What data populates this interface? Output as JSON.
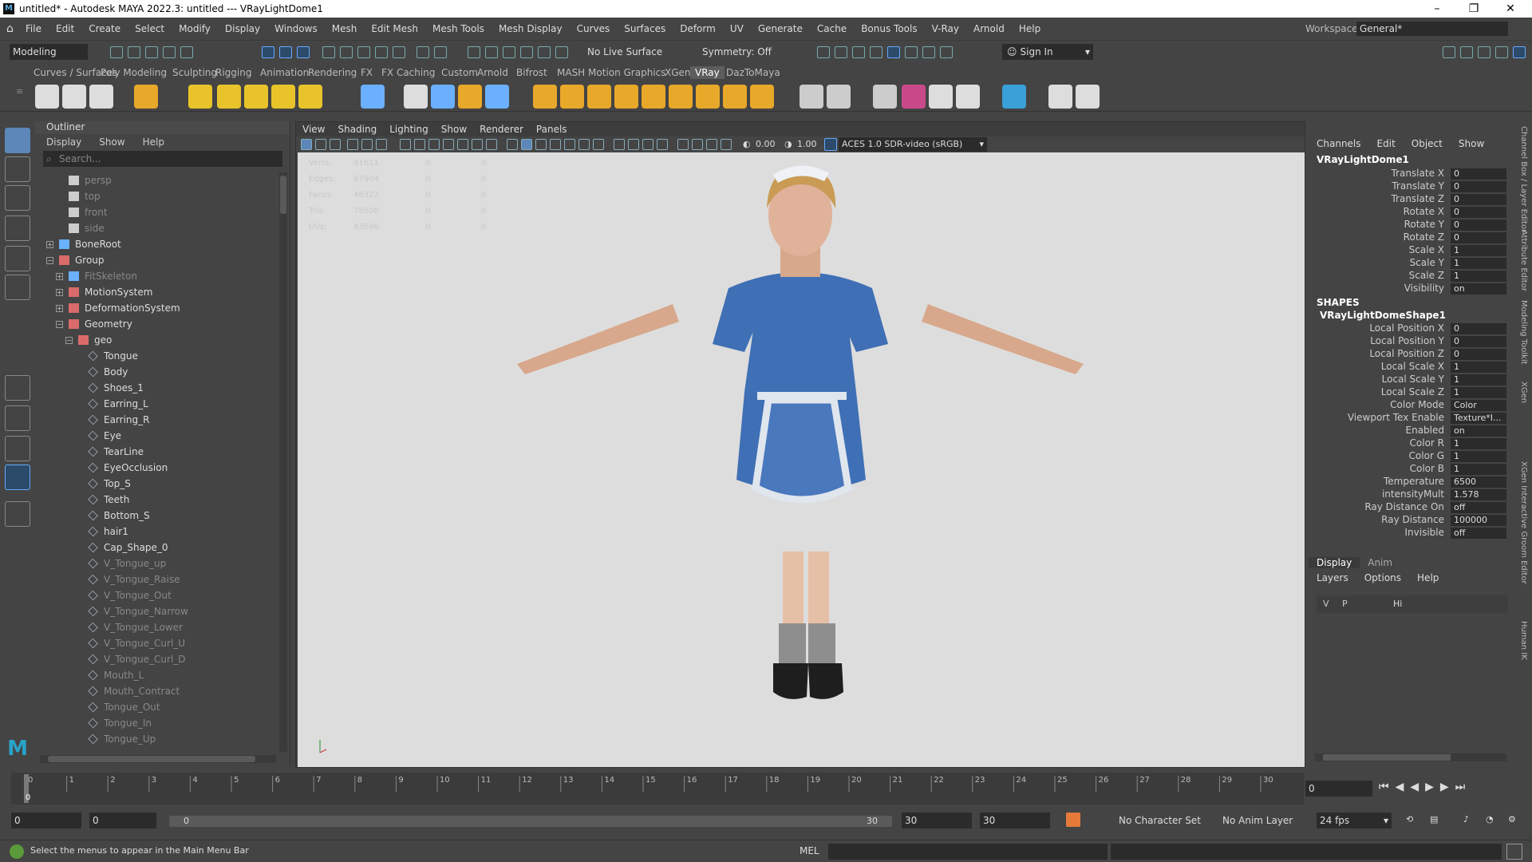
{
  "window": {
    "title": "untitled* - Autodesk MAYA 2022.3: untitled  ---  VRayLightDome1",
    "minimize": "–",
    "maximize": "❐",
    "close": "✕"
  },
  "menubar": {
    "items": [
      "File",
      "Edit",
      "Create",
      "Select",
      "Modify",
      "Display",
      "Windows",
      "Mesh",
      "Edit Mesh",
      "Mesh Tools",
      "Mesh Display",
      "Curves",
      "Surfaces",
      "Deform",
      "UV",
      "Generate",
      "Cache",
      "Bonus Tools",
      "V-Ray",
      "Arnold",
      "Help"
    ],
    "workspace_label": "Workspace:",
    "workspace_value": "General*"
  },
  "statusline": {
    "mode": "Modeling",
    "live_surface": "No Live Surface",
    "symmetry": "Symmetry: Off",
    "sign_in": "Sign In"
  },
  "shelf": {
    "tabs": [
      "Curves / Surfaces",
      "Poly Modeling",
      "Sculpting",
      "Rigging",
      "Animation",
      "Rendering",
      "FX",
      "FX Caching",
      "Custom",
      "Arnold",
      "Bifrost",
      "MASH",
      "Motion Graphics",
      "XGen",
      "VRay",
      "DazToMaya"
    ],
    "active": "VRay"
  },
  "outliner": {
    "title": "Outliner",
    "menu": [
      "Display",
      "Show",
      "Help"
    ],
    "search_placeholder": "Search...",
    "items": [
      {
        "label": "persp",
        "dim": true,
        "depth": 1,
        "kind": "cam",
        "exp": ""
      },
      {
        "label": "top",
        "dim": true,
        "depth": 1,
        "kind": "cam",
        "exp": ""
      },
      {
        "label": "front",
        "dim": true,
        "depth": 1,
        "kind": "cam",
        "exp": ""
      },
      {
        "label": "side",
        "dim": true,
        "depth": 1,
        "kind": "cam",
        "exp": ""
      },
      {
        "label": "BoneRoot",
        "dim": false,
        "depth": 0,
        "kind": "joint",
        "exp": "+"
      },
      {
        "label": "Group",
        "dim": false,
        "depth": 0,
        "kind": "group",
        "exp": "−"
      },
      {
        "label": "FitSkeleton",
        "dim": true,
        "depth": 1,
        "kind": "joint",
        "exp": "+"
      },
      {
        "label": "MotionSystem",
        "dim": false,
        "depth": 1,
        "kind": "group",
        "exp": "+"
      },
      {
        "label": "DeformationSystem",
        "dim": false,
        "depth": 1,
        "kind": "group",
        "exp": "+"
      },
      {
        "label": "Geometry",
        "dim": false,
        "depth": 1,
        "kind": "group",
        "exp": "−"
      },
      {
        "label": "geo",
        "dim": false,
        "depth": 2,
        "kind": "group",
        "exp": "−"
      },
      {
        "label": "Tongue",
        "dim": false,
        "depth": 3,
        "kind": "mesh",
        "exp": ""
      },
      {
        "label": "Body",
        "dim": false,
        "depth": 3,
        "kind": "mesh",
        "exp": ""
      },
      {
        "label": "Shoes_1",
        "dim": false,
        "depth": 3,
        "kind": "mesh",
        "exp": ""
      },
      {
        "label": "Earring_L",
        "dim": false,
        "depth": 3,
        "kind": "mesh",
        "exp": ""
      },
      {
        "label": "Earring_R",
        "dim": false,
        "depth": 3,
        "kind": "mesh",
        "exp": ""
      },
      {
        "label": "Eye",
        "dim": false,
        "depth": 3,
        "kind": "mesh",
        "exp": ""
      },
      {
        "label": "TearLine",
        "dim": false,
        "depth": 3,
        "kind": "mesh",
        "exp": ""
      },
      {
        "label": "EyeOcclusion",
        "dim": false,
        "depth": 3,
        "kind": "mesh",
        "exp": ""
      },
      {
        "label": "Top_S",
        "dim": false,
        "depth": 3,
        "kind": "mesh",
        "exp": ""
      },
      {
        "label": "Teeth",
        "dim": false,
        "depth": 3,
        "kind": "mesh",
        "exp": ""
      },
      {
        "label": "Bottom_S",
        "dim": false,
        "depth": 3,
        "kind": "mesh",
        "exp": ""
      },
      {
        "label": "hair1",
        "dim": false,
        "depth": 3,
        "kind": "mesh",
        "exp": ""
      },
      {
        "label": "Cap_Shape_0",
        "dim": false,
        "depth": 3,
        "kind": "mesh",
        "exp": ""
      },
      {
        "label": "V_Tongue_up",
        "dim": true,
        "depth": 3,
        "kind": "mesh",
        "exp": ""
      },
      {
        "label": "V_Tongue_Raise",
        "dim": true,
        "depth": 3,
        "kind": "mesh",
        "exp": ""
      },
      {
        "label": "V_Tongue_Out",
        "dim": true,
        "depth": 3,
        "kind": "mesh",
        "exp": ""
      },
      {
        "label": "V_Tongue_Narrow",
        "dim": true,
        "depth": 3,
        "kind": "mesh",
        "exp": ""
      },
      {
        "label": "V_Tongue_Lower",
        "dim": true,
        "depth": 3,
        "kind": "mesh",
        "exp": ""
      },
      {
        "label": "V_Tongue_Curl_U",
        "dim": true,
        "depth": 3,
        "kind": "mesh",
        "exp": ""
      },
      {
        "label": "V_Tongue_Curl_D",
        "dim": true,
        "depth": 3,
        "kind": "mesh",
        "exp": ""
      },
      {
        "label": "Mouth_L",
        "dim": true,
        "depth": 3,
        "kind": "mesh",
        "exp": ""
      },
      {
        "label": "Mouth_Contract",
        "dim": true,
        "depth": 3,
        "kind": "mesh",
        "exp": ""
      },
      {
        "label": "Tongue_Out",
        "dim": true,
        "depth": 3,
        "kind": "mesh",
        "exp": ""
      },
      {
        "label": "Tongue_In",
        "dim": true,
        "depth": 3,
        "kind": "mesh",
        "exp": ""
      },
      {
        "label": "Tongue_Up",
        "dim": true,
        "depth": 3,
        "kind": "mesh",
        "exp": ""
      }
    ]
  },
  "viewport": {
    "menu": [
      "View",
      "Shading",
      "Lighting",
      "Show",
      "Renderer",
      "Panels"
    ],
    "exposure": "0.00",
    "gamma": "1.00",
    "color_space": "ACES 1.0 SDR-video (sRGB)",
    "hud": [
      {
        "label": "Verts:",
        "v1": "41611",
        "v2": "0",
        "v3": "0"
      },
      {
        "label": "Edges:",
        "v1": "87904",
        "v2": "0",
        "v3": "0"
      },
      {
        "label": "Faces:",
        "v1": "46322",
        "v2": "0",
        "v3": "0"
      },
      {
        "label": "Tris:",
        "v1": "78600",
        "v2": "0",
        "v3": "0"
      },
      {
        "label": "UVs:",
        "v1": "43696",
        "v2": "0",
        "v3": "0"
      }
    ]
  },
  "channelbox": {
    "menu": [
      "Channels",
      "Edit",
      "Object",
      "Show"
    ],
    "object": "VRayLightDome1",
    "transform": [
      {
        "label": "Translate X",
        "value": "0"
      },
      {
        "label": "Translate Y",
        "value": "0"
      },
      {
        "label": "Translate Z",
        "value": "0"
      },
      {
        "label": "Rotate X",
        "value": "0"
      },
      {
        "label": "Rotate Y",
        "value": "0"
      },
      {
        "label": "Rotate Z",
        "value": "0"
      },
      {
        "label": "Scale X",
        "value": "1"
      },
      {
        "label": "Scale Y",
        "value": "1"
      },
      {
        "label": "Scale Z",
        "value": "1"
      },
      {
        "label": "Visibility",
        "value": "on"
      }
    ],
    "shapes_header": "SHAPES",
    "shape_name": "VRayLightDomeShape1",
    "shape_attrs": [
      {
        "label": "Local Position X",
        "value": "0"
      },
      {
        "label": "Local Position Y",
        "value": "0"
      },
      {
        "label": "Local Position Z",
        "value": "0"
      },
      {
        "label": "Local Scale X",
        "value": "1"
      },
      {
        "label": "Local Scale Y",
        "value": "1"
      },
      {
        "label": "Local Scale Z",
        "value": "1"
      },
      {
        "label": "Color Mode",
        "value": "Color"
      },
      {
        "label": "Viewport Tex Enable",
        "value": "Texture*I..."
      },
      {
        "label": "Enabled",
        "value": "on"
      },
      {
        "label": "Color R",
        "value": "1"
      },
      {
        "label": "Color G",
        "value": "1"
      },
      {
        "label": "Color B",
        "value": "1"
      },
      {
        "label": "Temperature",
        "value": "6500"
      },
      {
        "label": "intensityMult",
        "value": "1.578"
      },
      {
        "label": "Ray Distance On",
        "value": "off"
      },
      {
        "label": "Ray Distance",
        "value": "100000"
      },
      {
        "label": "Invisible",
        "value": "off"
      }
    ]
  },
  "layereditor": {
    "tabs": [
      "Display",
      "Anim"
    ],
    "menu": [
      "Layers",
      "Options",
      "Help"
    ],
    "v": "V",
    "p": "P",
    "hi": "Hi"
  },
  "sidetabs": [
    "Channel Box / Layer Editor",
    "Attribute Editor",
    "Modeling Toolkit",
    "XGen",
    "XGen Interactive Groom Editor",
    "Human IK"
  ],
  "timeline": {
    "ticks": [
      "0",
      "1",
      "2",
      "3",
      "4",
      "5",
      "6",
      "7",
      "8",
      "9",
      "10",
      "11",
      "12",
      "13",
      "14",
      "15",
      "16",
      "17",
      "18",
      "19",
      "20",
      "21",
      "22",
      "23",
      "24",
      "25",
      "26",
      "27",
      "28",
      "29",
      "30"
    ],
    "current_frame": "0",
    "current_field": "0"
  },
  "range": {
    "start": "0",
    "start2": "0",
    "slider_start": "0",
    "slider_end": "30",
    "end": "30",
    "end2": "30",
    "character_set": "No Character Set",
    "anim_layer": "No Anim Layer",
    "fps": "24 fps"
  },
  "cmdline": {
    "help": "Select the menus to appear in the Main Menu Bar",
    "lang": "MEL"
  },
  "colors": {
    "accent": "#5c87b8",
    "viewport_bg": "#dddddd",
    "panel_bg": "#444444",
    "field_bg": "#2b2b2b"
  }
}
